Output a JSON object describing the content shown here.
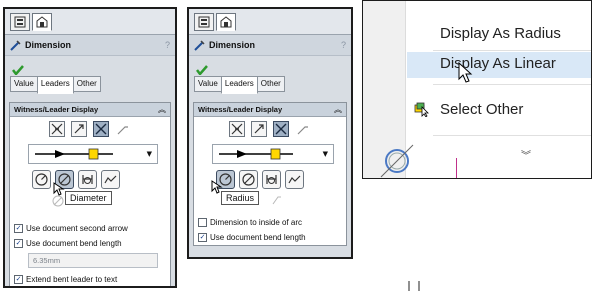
{
  "panel1": {
    "title": "Dimension",
    "help": "?",
    "tabs": [
      "Value",
      "Leaders",
      "Other"
    ],
    "group_title": "Witness/Leader Display",
    "tooltip": "Diameter",
    "checkboxes": [
      {
        "label": "Use document second arrow",
        "checked": true
      },
      {
        "label": "Use document bend length",
        "checked": true
      }
    ],
    "bend_length": "6.35mm",
    "extend_label": "Extend bent leader to text",
    "extend_checked": true
  },
  "panel2": {
    "title": "Dimension",
    "help": "?",
    "tabs": [
      "Value",
      "Leaders",
      "Other"
    ],
    "group_title": "Witness/Leader Display",
    "tooltip": "Radius",
    "checkboxes": [
      {
        "label": "Dimension to inside of arc",
        "checked": false
      },
      {
        "label": "Use document bend length",
        "checked": true
      }
    ]
  },
  "menu": {
    "items": [
      {
        "label": "Display As Radius"
      },
      {
        "label": "Display As Linear",
        "hovered": true
      },
      {
        "label": "Select Other"
      }
    ],
    "more_icon": "chevron-double-down-icon"
  },
  "colors": {
    "panel_bg": "#d8dde3",
    "menu_hover": "#d9e8f7",
    "check_green": "#2e9a2e",
    "highlight_yellow": "#ffd700"
  }
}
